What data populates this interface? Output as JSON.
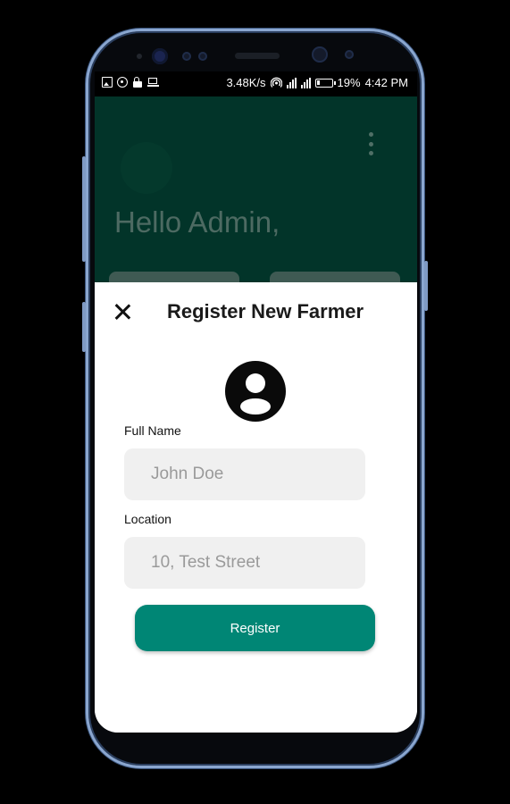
{
  "status_bar": {
    "speed": "3.48K/s",
    "battery": "19%",
    "time": "4:42 PM",
    "icons": [
      "gallery-icon",
      "sync-icon",
      "lock-icon",
      "laptop-icon",
      "hotspot-icon",
      "signal-icon",
      "signal-icon",
      "battery-icon"
    ]
  },
  "header": {
    "greeting": "Hello Admin,",
    "background_color": "#023429"
  },
  "sheet": {
    "title": "Register New Farmer",
    "close_icon": "close-icon",
    "profile_icon": "account-circle-icon",
    "fields": {
      "full_name": {
        "label": "Full Name",
        "placeholder": "John Doe",
        "value": ""
      },
      "location": {
        "label": "Location",
        "placeholder": "10, Test Street",
        "value": ""
      }
    },
    "register_label": "Register",
    "accent_color": "#008675"
  }
}
